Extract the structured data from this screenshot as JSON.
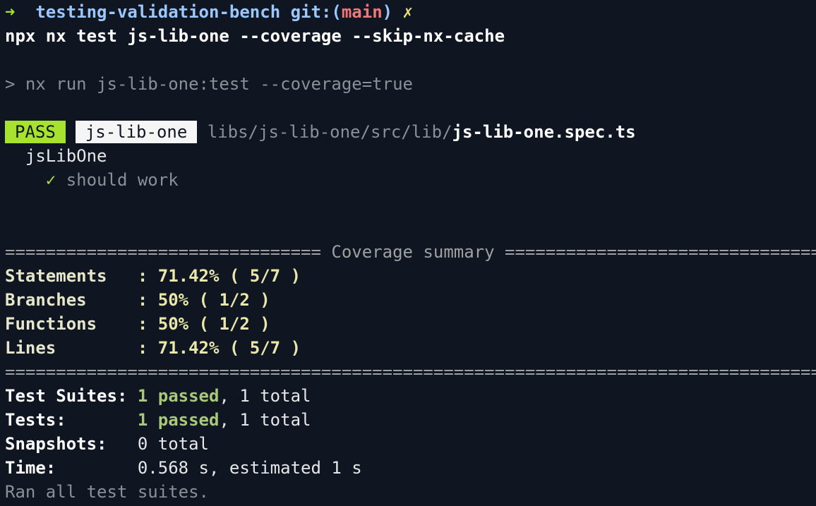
{
  "prompt": {
    "arrow": "➜",
    "directory": "testing-validation-bench",
    "git_prefix": "git:(",
    "branch": "main",
    "git_suffix": ")",
    "dirty_mark": "✗"
  },
  "command": "npx nx test js-lib-one --coverage --skip-nx-cache",
  "nx_run_line": "> nx run js-lib-one:test --coverage=true",
  "result": {
    "status": "PASS",
    "project": "js-lib-one",
    "path_prefix": "libs/js-lib-one/src/lib/",
    "file": "js-lib-one.spec.ts",
    "describe": "jsLibOne",
    "check_mark": "✓",
    "test_name": "should work"
  },
  "coverage": {
    "header": "=============================== Coverage summary ===============================",
    "footer": "================================================================================",
    "rows": [
      {
        "label": "Statements   ",
        "value": ": 71.42% ( 5/7 )"
      },
      {
        "label": "Branches     ",
        "value": ": 50% ( 1/2 )"
      },
      {
        "label": "Functions    ",
        "value": ": 50% ( 1/2 )"
      },
      {
        "label": "Lines        ",
        "value": ": 71.42% ( 5/7 )"
      }
    ]
  },
  "summary": {
    "suites_label": "Test Suites: ",
    "suites_passed": "1 passed",
    "suites_rest": ", 1 total",
    "tests_label": "Tests:       ",
    "tests_passed": "1 passed",
    "tests_rest": ", 1 total",
    "snapshots_label": "Snapshots:   ",
    "snapshots_value": "0 total",
    "time_label": "Time:        ",
    "time_value": "0.568 s, estimated 1 s",
    "ran_all": "Ran all test suites."
  },
  "colors": {
    "background": "#0f1622",
    "pass": "#a6e22e",
    "branch": "#f07878",
    "directory": "#9bc7ff"
  }
}
